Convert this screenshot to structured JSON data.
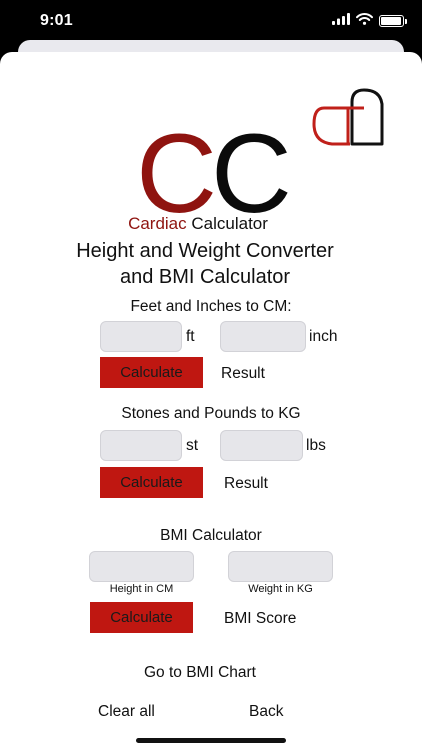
{
  "status_bar": {
    "time": "9:01",
    "battery_level": 0.95
  },
  "logo": {
    "letter_1": "C",
    "letter_2": "C",
    "sub_red": "Cardiac",
    "sub_dark": " Calculator",
    "brand_red": "#8f1410",
    "brand_dark": "#0b0b0b"
  },
  "title_line1": "Height and Weight Converter",
  "title_line2": "and BMI Calculator",
  "feet_section": {
    "title": "Feet and Inches to CM:",
    "feet_value": "",
    "feet_unit": "ft",
    "inch_value": "",
    "inch_unit": "inch",
    "calculate_label": "Calculate",
    "result_label": "Result"
  },
  "stones_section": {
    "title": "Stones and Pounds to KG",
    "stones_value": "",
    "stones_unit": "st",
    "pounds_value": "",
    "pounds_unit": "lbs",
    "calculate_label": "Calculate",
    "result_label": "Result"
  },
  "bmi_section": {
    "title": "BMI Calculator",
    "height_value": "",
    "height_label": "Height in CM",
    "weight_value": "",
    "weight_label": "Weight in KG",
    "calculate_label": "Calculate",
    "result_label": "BMI Score"
  },
  "links": {
    "bmi_chart": "Go to BMI Chart",
    "clear_all": "Clear all",
    "back": "Back"
  },
  "colors": {
    "button_red": "#bf1711",
    "field_bg": "#e6e6ea"
  }
}
